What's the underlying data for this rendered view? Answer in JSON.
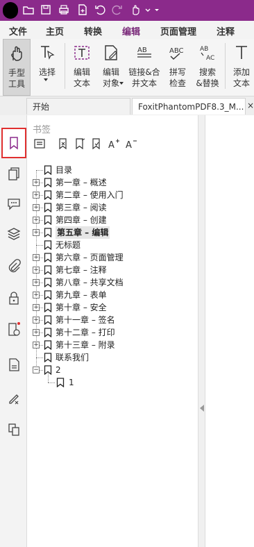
{
  "menu": {
    "items": [
      {
        "label": "文件",
        "name": "menu-file"
      },
      {
        "label": "主页",
        "name": "menu-home"
      },
      {
        "label": "转换",
        "name": "menu-convert"
      },
      {
        "label": "编辑",
        "name": "menu-edit",
        "active": true
      },
      {
        "label": "页面管理",
        "name": "menu-page-manage"
      },
      {
        "label": "注释",
        "name": "menu-comment"
      }
    ]
  },
  "ribbon": {
    "hand_tool": "手型\n工具",
    "select": "选择",
    "edit_text": "编辑\n文本",
    "edit_object": "编辑\n对象",
    "link_merge": "链接&合\n并文本",
    "spell_check": "拼写\n检查",
    "search_replace": "搜索\n&替换",
    "add_text": "添加\n文本"
  },
  "tabs": {
    "start": "开始",
    "document": "FoxitPhantomPDF8.3_M...",
    "close": "×"
  },
  "panel": {
    "title": "书签"
  },
  "bookmarks": [
    {
      "label": "目录",
      "expand": false
    },
    {
      "label": "第一章 – 概述",
      "expand": true
    },
    {
      "label": "第二章 – 使用入门",
      "expand": true
    },
    {
      "label": "第三章 – 阅读",
      "expand": true
    },
    {
      "label": "第四章 – 创建",
      "expand": true
    },
    {
      "label": "第五章 – 编辑",
      "expand": true,
      "selected": true
    },
    {
      "label": "无标题",
      "expand": false
    },
    {
      "label": "第六章 – 页面管理",
      "expand": true
    },
    {
      "label": "第七章 – 注释",
      "expand": true
    },
    {
      "label": "第八章 – 共享文档",
      "expand": true
    },
    {
      "label": "第九章 – 表单",
      "expand": true
    },
    {
      "label": "第十章 – 安全",
      "expand": true
    },
    {
      "label": "第十一章 – 签名",
      "expand": true
    },
    {
      "label": "第十二章 – 打印",
      "expand": true
    },
    {
      "label": "第十三章 – 附录",
      "expand": true
    },
    {
      "label": "联系我们",
      "expand": false
    },
    {
      "label": "2",
      "expand": "open"
    }
  ],
  "sub_bookmark": {
    "label": "1"
  },
  "colors": {
    "accent": "#8b2a8b",
    "highlight_border": "#e03030"
  }
}
